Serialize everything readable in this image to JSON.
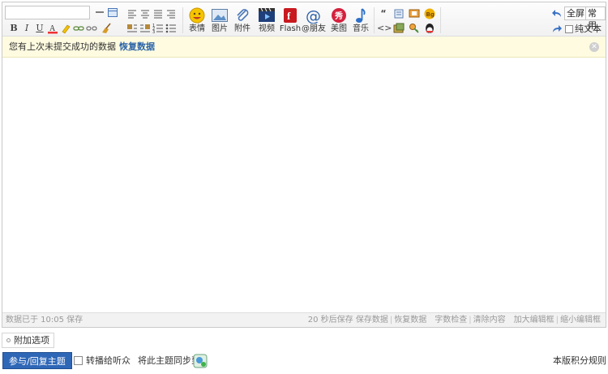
{
  "toolbar": {
    "font_box_value": "",
    "buttons": [
      {
        "label": "表情",
        "icon": "emoji-icon"
      },
      {
        "label": "图片",
        "icon": "image-icon"
      },
      {
        "label": "附件",
        "icon": "attachment-icon"
      },
      {
        "label": "视频",
        "icon": "video-icon"
      },
      {
        "label": "Flash",
        "icon": "flash-icon"
      },
      {
        "label": "@朋友",
        "icon": "at-icon"
      },
      {
        "label": "美图",
        "icon": "meitu-icon"
      },
      {
        "label": "音乐",
        "icon": "music-icon"
      }
    ],
    "fullscreen_label": "全屏",
    "common_label": "常用",
    "plain_text_label": "纯文本"
  },
  "notice": {
    "text": "您有上次未提交成功的数据",
    "link": "恢复数据"
  },
  "statusbar": {
    "saved_text": "数据已于 10:05 保存",
    "autosave_text": "20 秒后保存",
    "save_link": "保存数据",
    "restore_link": "恢复数据",
    "count_link": "字数检查",
    "clear_link": "清除内容",
    "enlarge_link": "加大编辑框",
    "shrink_link": "缩小编辑框",
    "separator": "|"
  },
  "options": {
    "extra_label": "附加选项"
  },
  "footer": {
    "submit_label": "参与/回复主题",
    "broadcast_label": "转播给听众",
    "sync_label": "将此主题同步到:",
    "rules_label": "本版积分规则"
  },
  "colors": {
    "accent": "#2f67b7",
    "link": "#2b64a8",
    "notice_bg": "#fefbe0"
  }
}
